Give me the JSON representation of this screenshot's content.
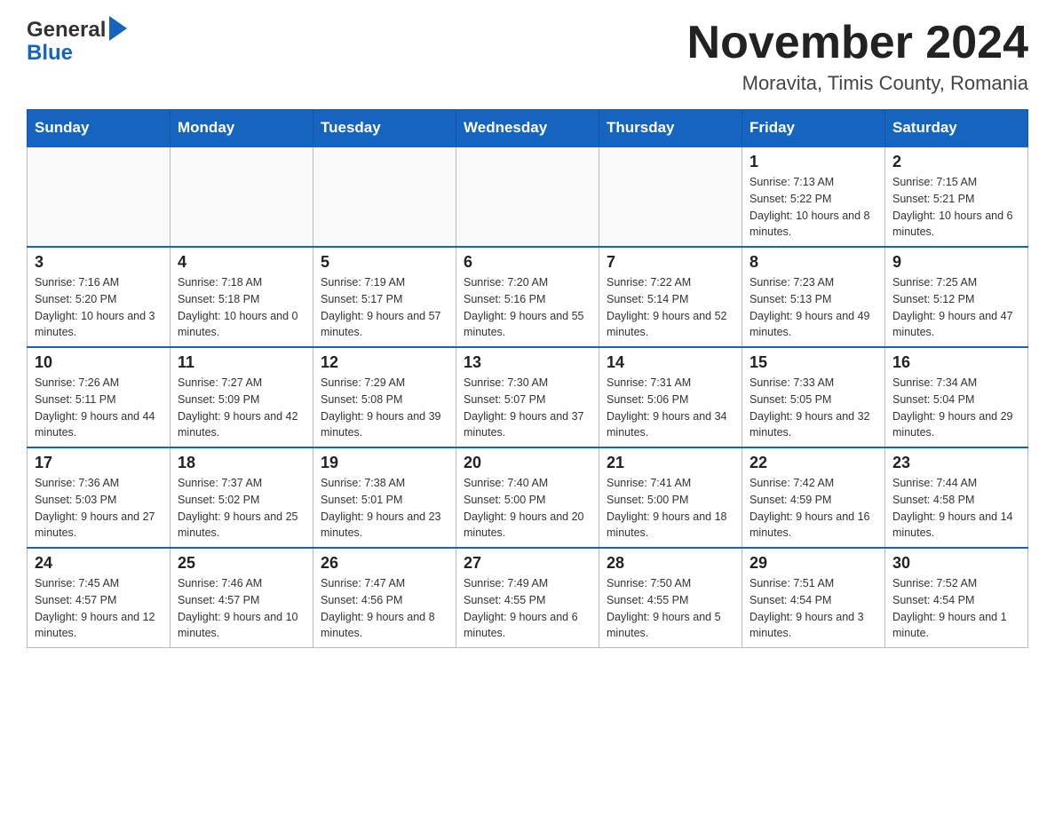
{
  "header": {
    "logo": {
      "part1": "General",
      "part2": "Blue"
    },
    "title": "November 2024",
    "location": "Moravita, Timis County, Romania"
  },
  "days_of_week": [
    "Sunday",
    "Monday",
    "Tuesday",
    "Wednesday",
    "Thursday",
    "Friday",
    "Saturday"
  ],
  "weeks": [
    [
      {
        "day": "",
        "sunrise": "",
        "sunset": "",
        "daylight": ""
      },
      {
        "day": "",
        "sunrise": "",
        "sunset": "",
        "daylight": ""
      },
      {
        "day": "",
        "sunrise": "",
        "sunset": "",
        "daylight": ""
      },
      {
        "day": "",
        "sunrise": "",
        "sunset": "",
        "daylight": ""
      },
      {
        "day": "",
        "sunrise": "",
        "sunset": "",
        "daylight": ""
      },
      {
        "day": "1",
        "sunrise": "Sunrise: 7:13 AM",
        "sunset": "Sunset: 5:22 PM",
        "daylight": "Daylight: 10 hours and 8 minutes."
      },
      {
        "day": "2",
        "sunrise": "Sunrise: 7:15 AM",
        "sunset": "Sunset: 5:21 PM",
        "daylight": "Daylight: 10 hours and 6 minutes."
      }
    ],
    [
      {
        "day": "3",
        "sunrise": "Sunrise: 7:16 AM",
        "sunset": "Sunset: 5:20 PM",
        "daylight": "Daylight: 10 hours and 3 minutes."
      },
      {
        "day": "4",
        "sunrise": "Sunrise: 7:18 AM",
        "sunset": "Sunset: 5:18 PM",
        "daylight": "Daylight: 10 hours and 0 minutes."
      },
      {
        "day": "5",
        "sunrise": "Sunrise: 7:19 AM",
        "sunset": "Sunset: 5:17 PM",
        "daylight": "Daylight: 9 hours and 57 minutes."
      },
      {
        "day": "6",
        "sunrise": "Sunrise: 7:20 AM",
        "sunset": "Sunset: 5:16 PM",
        "daylight": "Daylight: 9 hours and 55 minutes."
      },
      {
        "day": "7",
        "sunrise": "Sunrise: 7:22 AM",
        "sunset": "Sunset: 5:14 PM",
        "daylight": "Daylight: 9 hours and 52 minutes."
      },
      {
        "day": "8",
        "sunrise": "Sunrise: 7:23 AM",
        "sunset": "Sunset: 5:13 PM",
        "daylight": "Daylight: 9 hours and 49 minutes."
      },
      {
        "day": "9",
        "sunrise": "Sunrise: 7:25 AM",
        "sunset": "Sunset: 5:12 PM",
        "daylight": "Daylight: 9 hours and 47 minutes."
      }
    ],
    [
      {
        "day": "10",
        "sunrise": "Sunrise: 7:26 AM",
        "sunset": "Sunset: 5:11 PM",
        "daylight": "Daylight: 9 hours and 44 minutes."
      },
      {
        "day": "11",
        "sunrise": "Sunrise: 7:27 AM",
        "sunset": "Sunset: 5:09 PM",
        "daylight": "Daylight: 9 hours and 42 minutes."
      },
      {
        "day": "12",
        "sunrise": "Sunrise: 7:29 AM",
        "sunset": "Sunset: 5:08 PM",
        "daylight": "Daylight: 9 hours and 39 minutes."
      },
      {
        "day": "13",
        "sunrise": "Sunrise: 7:30 AM",
        "sunset": "Sunset: 5:07 PM",
        "daylight": "Daylight: 9 hours and 37 minutes."
      },
      {
        "day": "14",
        "sunrise": "Sunrise: 7:31 AM",
        "sunset": "Sunset: 5:06 PM",
        "daylight": "Daylight: 9 hours and 34 minutes."
      },
      {
        "day": "15",
        "sunrise": "Sunrise: 7:33 AM",
        "sunset": "Sunset: 5:05 PM",
        "daylight": "Daylight: 9 hours and 32 minutes."
      },
      {
        "day": "16",
        "sunrise": "Sunrise: 7:34 AM",
        "sunset": "Sunset: 5:04 PM",
        "daylight": "Daylight: 9 hours and 29 minutes."
      }
    ],
    [
      {
        "day": "17",
        "sunrise": "Sunrise: 7:36 AM",
        "sunset": "Sunset: 5:03 PM",
        "daylight": "Daylight: 9 hours and 27 minutes."
      },
      {
        "day": "18",
        "sunrise": "Sunrise: 7:37 AM",
        "sunset": "Sunset: 5:02 PM",
        "daylight": "Daylight: 9 hours and 25 minutes."
      },
      {
        "day": "19",
        "sunrise": "Sunrise: 7:38 AM",
        "sunset": "Sunset: 5:01 PM",
        "daylight": "Daylight: 9 hours and 23 minutes."
      },
      {
        "day": "20",
        "sunrise": "Sunrise: 7:40 AM",
        "sunset": "Sunset: 5:00 PM",
        "daylight": "Daylight: 9 hours and 20 minutes."
      },
      {
        "day": "21",
        "sunrise": "Sunrise: 7:41 AM",
        "sunset": "Sunset: 5:00 PM",
        "daylight": "Daylight: 9 hours and 18 minutes."
      },
      {
        "day": "22",
        "sunrise": "Sunrise: 7:42 AM",
        "sunset": "Sunset: 4:59 PM",
        "daylight": "Daylight: 9 hours and 16 minutes."
      },
      {
        "day": "23",
        "sunrise": "Sunrise: 7:44 AM",
        "sunset": "Sunset: 4:58 PM",
        "daylight": "Daylight: 9 hours and 14 minutes."
      }
    ],
    [
      {
        "day": "24",
        "sunrise": "Sunrise: 7:45 AM",
        "sunset": "Sunset: 4:57 PM",
        "daylight": "Daylight: 9 hours and 12 minutes."
      },
      {
        "day": "25",
        "sunrise": "Sunrise: 7:46 AM",
        "sunset": "Sunset: 4:57 PM",
        "daylight": "Daylight: 9 hours and 10 minutes."
      },
      {
        "day": "26",
        "sunrise": "Sunrise: 7:47 AM",
        "sunset": "Sunset: 4:56 PM",
        "daylight": "Daylight: 9 hours and 8 minutes."
      },
      {
        "day": "27",
        "sunrise": "Sunrise: 7:49 AM",
        "sunset": "Sunset: 4:55 PM",
        "daylight": "Daylight: 9 hours and 6 minutes."
      },
      {
        "day": "28",
        "sunrise": "Sunrise: 7:50 AM",
        "sunset": "Sunset: 4:55 PM",
        "daylight": "Daylight: 9 hours and 5 minutes."
      },
      {
        "day": "29",
        "sunrise": "Sunrise: 7:51 AM",
        "sunset": "Sunset: 4:54 PM",
        "daylight": "Daylight: 9 hours and 3 minutes."
      },
      {
        "day": "30",
        "sunrise": "Sunrise: 7:52 AM",
        "sunset": "Sunset: 4:54 PM",
        "daylight": "Daylight: 9 hours and 1 minute."
      }
    ]
  ]
}
